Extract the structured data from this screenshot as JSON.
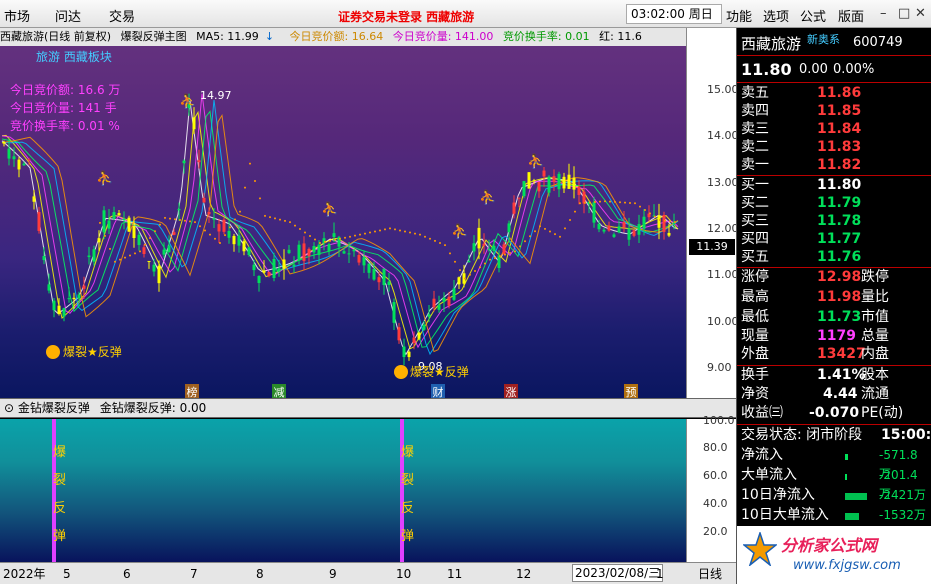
{
  "topbar": {
    "menu": [
      "市场",
      "问达",
      "交易"
    ],
    "notice": "证券交易未登录  西藏旅游",
    "time": "03:02:00",
    "weekday": "周日",
    "right_menu": [
      "功能",
      "选项",
      "公式",
      "版面"
    ]
  },
  "chart_head": {
    "title": "西藏旅游(日线 前复权)",
    "formula": "爆裂反弹主图",
    "ma5": "MA5: 11.99",
    "arrow": "↓",
    "amt_label": "今日竞价额: 16.64",
    "vol_label": "今日竞价量: 141.00",
    "turn_label": "竞价换手率: 0.01",
    "red_label": "红: 11.6"
  },
  "overlay": {
    "sector": "旅游 西藏板块",
    "amt": "今日竞价额: 16.6 万",
    "vol": "今日竞价量: 141 手",
    "turn": "竞价换手率: 0.01 %",
    "high_mark": "14.97",
    "low_mark": "9.08",
    "signal": "爆裂★反弹",
    "current_price": "11.39",
    "events": [
      "榜",
      "减",
      "财",
      "涨",
      "预"
    ]
  },
  "yticks": [
    "15.00",
    "14.00",
    "13.00",
    "12.00",
    "11.00",
    "10.00",
    "9.00"
  ],
  "sub_head": {
    "title": "金钻爆裂反弹",
    "value": "金钻爆裂反弹: 0.00",
    "chars": [
      "爆",
      "裂",
      "反",
      "弹"
    ]
  },
  "sub_yticks": [
    "100.0",
    "80.0",
    "60.0",
    "40.0",
    "20.0"
  ],
  "xaxis": {
    "labels": [
      "2022年",
      "5",
      "6",
      "7",
      "8",
      "9",
      "10",
      "11",
      "12",
      "2023/02/08/三",
      "1"
    ],
    "mode": "日线"
  },
  "quote": {
    "name": "西藏旅游",
    "tag": "新奥系",
    "code": "600749",
    "price": "11.80",
    "change": "0.00",
    "pct": "0.00%",
    "asks": [
      {
        "l": "卖五",
        "v": "11.86"
      },
      {
        "l": "卖四",
        "v": "11.85"
      },
      {
        "l": "卖三",
        "v": "11.84"
      },
      {
        "l": "卖二",
        "v": "11.83"
      },
      {
        "l": "卖一",
        "v": "11.82"
      }
    ],
    "bids": [
      {
        "l": "买一",
        "v": "11.80"
      },
      {
        "l": "买二",
        "v": "11.79"
      },
      {
        "l": "买三",
        "v": "11.78"
      },
      {
        "l": "买四",
        "v": "11.77"
      },
      {
        "l": "买五",
        "v": "11.76"
      }
    ],
    "stats": [
      {
        "l": "涨停",
        "v": "12.98",
        "r": "跌停"
      },
      {
        "l": "最高",
        "v": "11.98",
        "r": "量比"
      },
      {
        "l": "最低",
        "v": "11.73",
        "r": "市值"
      },
      {
        "l": "现量",
        "v": "1179",
        "r": "总量"
      },
      {
        "l": "外盘",
        "v": "13427",
        "r": "内盘"
      }
    ],
    "stats2": [
      {
        "l": "换手",
        "v": "1.41%",
        "r": "股本"
      },
      {
        "l": "净资",
        "v": "4.44",
        "r": "流通"
      },
      {
        "l": "收益㈢",
        "v": "-0.070",
        "r": "PE(动)"
      }
    ],
    "status_label": "交易状态: 闭市阶段",
    "status_time": "15:00:0",
    "flows": [
      {
        "l": "净流入",
        "v": "-571.8万"
      },
      {
        "l": "大单流入",
        "v": "-201.4万"
      },
      {
        "l": "10日净流入",
        "v": "-2421万"
      },
      {
        "l": "10日大单流入",
        "v": "-1532万"
      }
    ],
    "logo": "分析家公式网",
    "url": "www.fxjgsw.com"
  },
  "colors": {
    "up": "#ff3b3b",
    "down": "#00e05a",
    "cyan": "#00ffff",
    "magenta": "#ff40ff",
    "yellow": "#ffff00"
  }
}
